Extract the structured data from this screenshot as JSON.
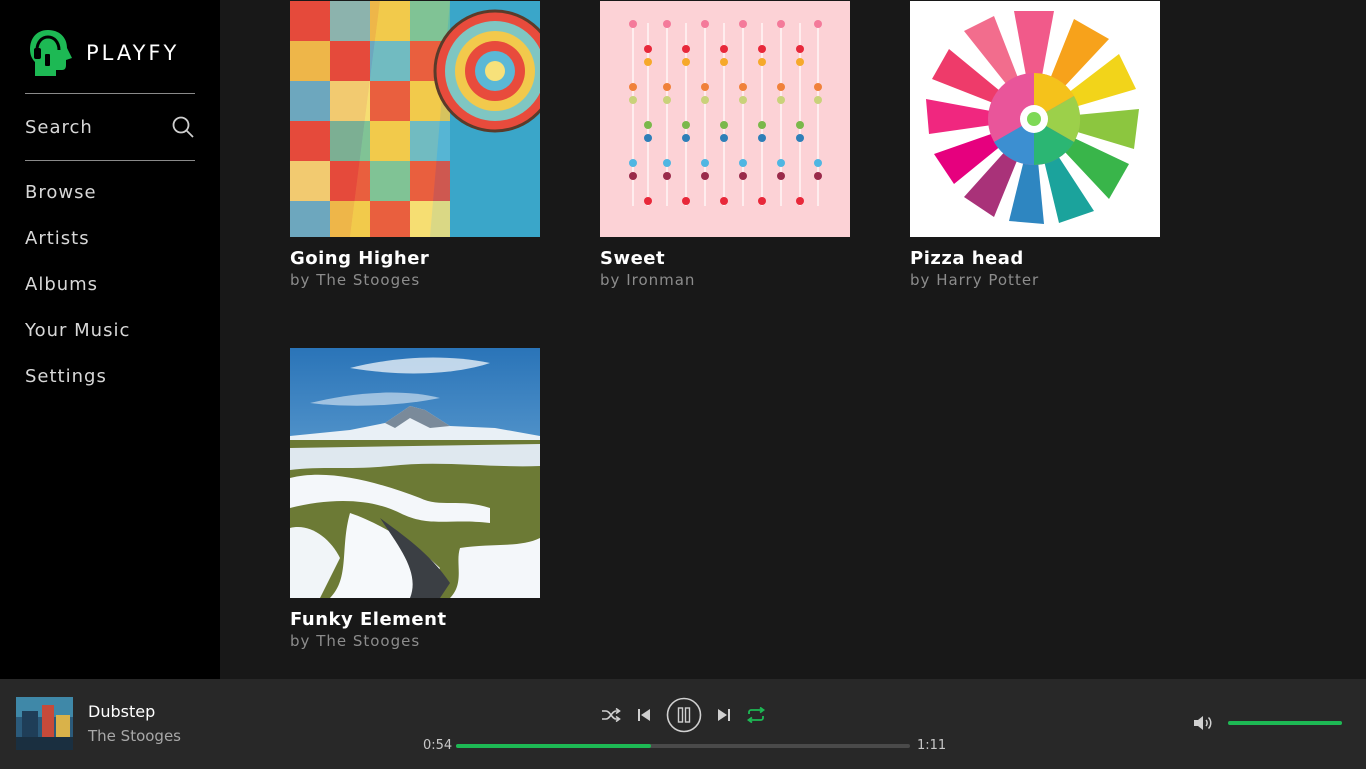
{
  "app": {
    "name": "PLAYFY",
    "accent": "#1db954"
  },
  "sidebar": {
    "search_label": "Search",
    "items": [
      {
        "label": "Browse"
      },
      {
        "label": "Artists"
      },
      {
        "label": "Albums"
      },
      {
        "label": "Your Music"
      },
      {
        "label": "Settings"
      }
    ]
  },
  "albums": [
    {
      "title": "Going Higher",
      "by": "by",
      "artist": "The Stooges",
      "art": "hot-air-balloon"
    },
    {
      "title": "Sweet",
      "by": "by",
      "artist": "Ironman",
      "art": "lollipops-pink"
    },
    {
      "title": "Pizza head",
      "by": "by",
      "artist": "Harry Potter",
      "art": "rainbow-flower"
    },
    {
      "title": "Funky Element",
      "by": "by",
      "artist": "The Stooges",
      "art": "snowy-mountain"
    }
  ],
  "player": {
    "track": "Dubstep",
    "artist": "The Stooges",
    "elapsed": "0:54",
    "duration": "1:11",
    "progress": 0.43,
    "volume": 1.0,
    "shuffle_icon": "shuffle-icon",
    "prev_icon": "previous-icon",
    "pause_icon": "pause-icon",
    "next_icon": "next-icon",
    "repeat_icon": "repeat-icon",
    "repeat_active": true
  }
}
